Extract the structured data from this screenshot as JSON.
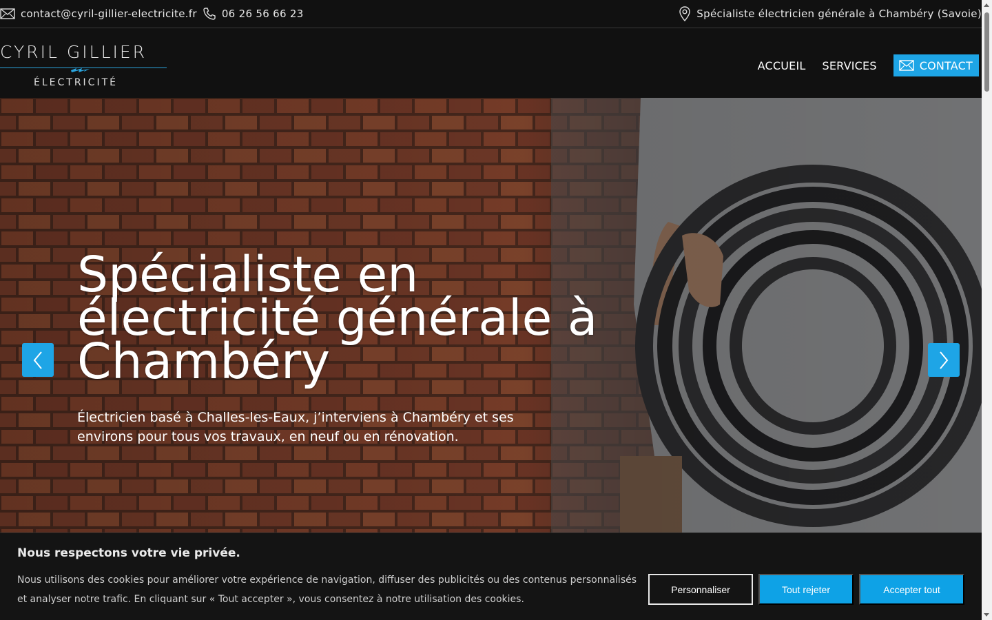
{
  "topbar": {
    "email": "contact@cyril-gillier-electricite.fr",
    "phone": "06 26 56 66 23",
    "location": "Spécialiste électricien générale à Chambéry (Savoie)"
  },
  "logo": {
    "name": "CYRIL GILLIER",
    "subtitle": "ÉLECTRICITÉ"
  },
  "nav": {
    "items": [
      "ACCUEIL",
      "SERVICES"
    ],
    "contact_label": "CONTACT"
  },
  "hero": {
    "title": "Spécialiste en électricité générale à Chambéry",
    "subtitle": "Électricien basé à Challes-les-Eaux, j’interviens à Chambéry et ses environs pour tous vos travaux, en neuf ou en rénovation."
  },
  "cookie": {
    "title": "Nous respectons votre vie privée.",
    "text": "Nous utilisons des cookies pour améliorer votre expérience de navigation, diffuser des publicités ou des contenus personnalisés et analyser notre trafic. En cliquant sur « Tout accepter », vous consentez à notre utilisation des cookies.",
    "customize_label": "Personnaliser",
    "reject_label": "Tout rejeter",
    "accept_label": "Accepter tout"
  },
  "colors": {
    "accent": "#1ea5e6",
    "background": "#111111"
  },
  "icons": [
    "mail-icon",
    "phone-icon",
    "map-pin-icon",
    "chevron-left-icon",
    "chevron-right-icon",
    "bolt-icon"
  ]
}
